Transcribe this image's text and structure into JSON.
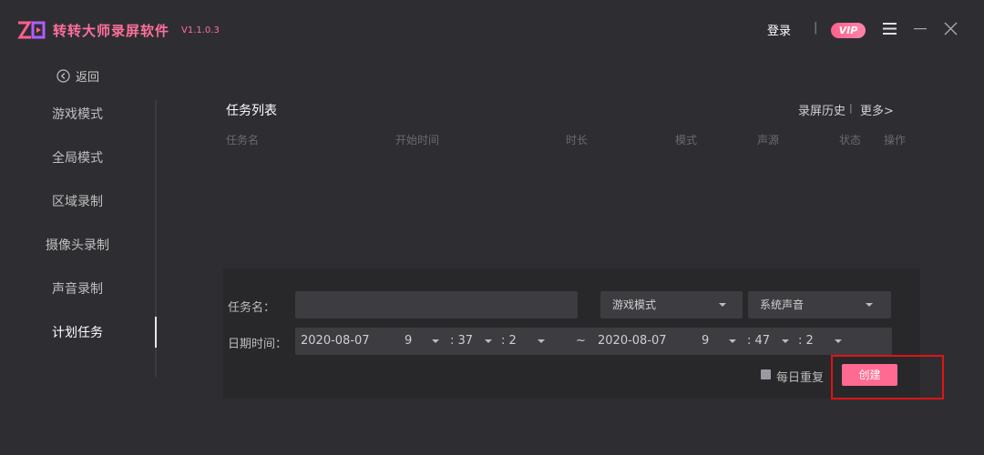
{
  "app": {
    "title": "转转大师录屏软件",
    "version": "V1.1.0.3",
    "login": "登录",
    "separator": "|",
    "vip": "VIP",
    "icons": [
      "logo-mark",
      "menu-icon",
      "minimize-icon",
      "close-icon"
    ],
    "brand_color": "#ff6f9c"
  },
  "sidebar": {
    "back": "返回",
    "items": [
      {
        "label": "游戏模式"
      },
      {
        "label": "全局模式"
      },
      {
        "label": "区域录制"
      },
      {
        "label": "摄像头录制"
      },
      {
        "label": "声音录制"
      },
      {
        "label": "计划任务",
        "active": true
      }
    ]
  },
  "tasks": {
    "title": "任务列表",
    "history": "录屏历史",
    "history_sep": "|",
    "more": "更多>",
    "columns": [
      "任务名",
      "开始时间",
      "时长",
      "模式",
      "声源",
      "状态",
      "操作"
    ],
    "rows": []
  },
  "form": {
    "task_name_label": "任务名：",
    "task_name_value": "",
    "mode": "游戏模式",
    "audio": "系统声音",
    "datetime_label": "日期时间：",
    "start": {
      "date": "2020-08-07",
      "hour": "9",
      "minute": ": 37",
      "second": ": 2"
    },
    "tilde": "~",
    "end": {
      "date": "2020-08-07",
      "hour": "9",
      "minute": ": 47",
      "second": ": 2"
    },
    "repeat_label": "每日重复",
    "repeat_checked": false,
    "create": "创建",
    "accent_color": "#ff6a93"
  }
}
